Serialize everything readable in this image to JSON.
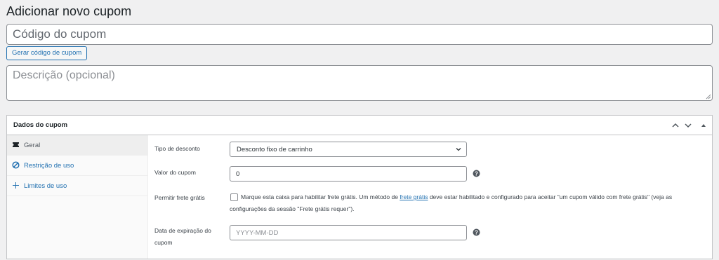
{
  "page": {
    "title": "Adicionar novo cupom",
    "code_placeholder": "Código do cupom",
    "generate_button": "Gerar código de cupom",
    "description_placeholder": "Descrição (opcional)"
  },
  "coupon_panel": {
    "title": "Dados do cupom",
    "header_icons": [
      "chevron-up-icon",
      "chevron-down-icon",
      "toggle-arrow-icon"
    ],
    "tabs": [
      {
        "label": "Geral",
        "icon": "ticket-icon",
        "active": true
      },
      {
        "label": "Restrição de uso",
        "icon": "block-icon",
        "active": false
      },
      {
        "label": "Limites de uso",
        "icon": "plus-icon",
        "active": false
      }
    ],
    "fields": {
      "discount_type": {
        "label": "Tipo de desconto",
        "value": "Desconto fixo de carrinho"
      },
      "coupon_amount": {
        "label": "Valor do cupom",
        "value": "0"
      },
      "free_shipping": {
        "label": "Permitir frete grátis",
        "text_before": "Marque esta caixa para habilitar frete grátis. Um método de ",
        "link": "frete grátis",
        "text_after": " deve estar habilitado e configurado para aceitar \"um cupom válido com frete grátis\" (veja as configurações da sessão \"Frete grátis requer\")."
      },
      "expiry_date": {
        "label": "Data de expiração do cupom",
        "placeholder": "YYYY-MM-DD"
      }
    }
  },
  "colors": {
    "link": "#2271b1",
    "background": "#f0f0f1",
    "border": "#8c8f94"
  }
}
